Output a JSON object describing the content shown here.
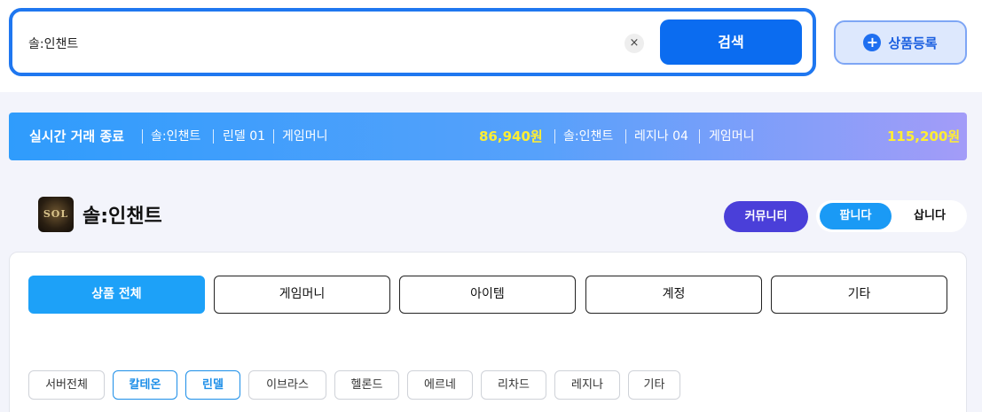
{
  "search": {
    "value": "솔:인챈트",
    "clear_label": "×",
    "button_label": "검색"
  },
  "register": {
    "icon": "+",
    "label": "상품등록"
  },
  "ticker": {
    "title": "실시간 거래 종료",
    "items": [
      {
        "game": "솔:인챈트",
        "server": "린델 01",
        "category": "게임머니",
        "price": "86,940원"
      },
      {
        "game": "솔:인챈트",
        "server": "레지나 04",
        "category": "게임머니",
        "price": "115,200원"
      }
    ]
  },
  "game": {
    "logo_text": "SOL",
    "title": "솔:인챈트"
  },
  "actions": {
    "community_label": "커뮤니티",
    "sell_label": "팝니다",
    "buy_label": "삽니다"
  },
  "categories": [
    {
      "label": "상품 전체",
      "active": true
    },
    {
      "label": "게임머니",
      "active": false
    },
    {
      "label": "아이템",
      "active": false
    },
    {
      "label": "계정",
      "active": false
    },
    {
      "label": "기타",
      "active": false
    }
  ],
  "servers": [
    {
      "label": "서버전체",
      "selected": false
    },
    {
      "label": "칼테온",
      "selected": true
    },
    {
      "label": "린델",
      "selected": true
    },
    {
      "label": "이브라스",
      "selected": false
    },
    {
      "label": "헬론드",
      "selected": false
    },
    {
      "label": "에르네",
      "selected": false
    },
    {
      "label": "리차드",
      "selected": false
    },
    {
      "label": "레지나",
      "selected": false
    },
    {
      "label": "기타",
      "selected": false
    }
  ],
  "colors": {
    "primary": "#0b6cf0",
    "accent": "#1da1f8",
    "community": "#4a3fd9",
    "ticker_price": "#ffee33"
  }
}
